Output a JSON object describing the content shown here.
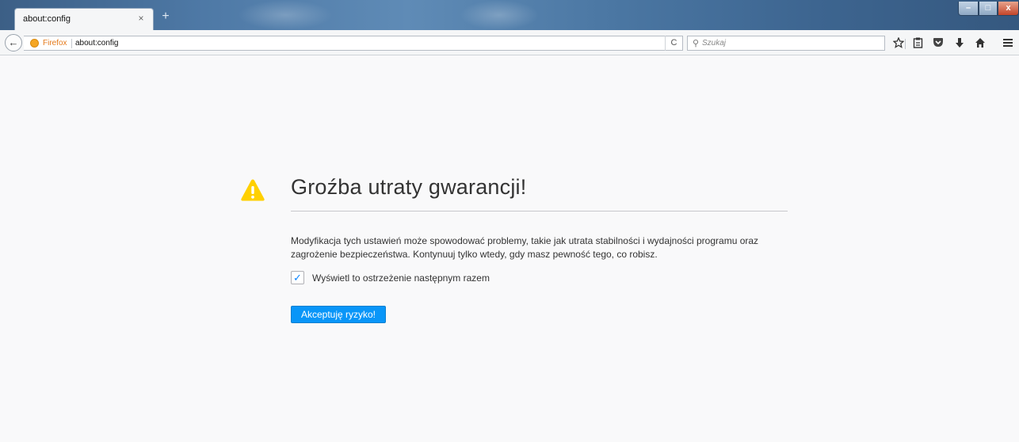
{
  "tab": {
    "title": "about:config",
    "close_glyph": "×",
    "new_tab_glyph": "+"
  },
  "window_controls": {
    "minimize": "–",
    "maximize": "□",
    "close": "x"
  },
  "navbar": {
    "back_glyph": "←",
    "identity_label": "Firefox",
    "url": "about:config",
    "reload_glyph": "C",
    "search_placeholder": "Szukaj",
    "search_icon_glyph": "⚲",
    "toolbar_icons": [
      "star-icon",
      "reading-list-icon",
      "pocket-icon",
      "download-icon",
      "home-icon",
      "menu-icon"
    ]
  },
  "warning": {
    "title": "Groźba utraty gwarancji!",
    "description": "Modyfikacja tych ustawień może spowodować problemy, takie jak utrata stabilności i wydajności programu oraz zagrożenie bezpieczeństwa. Kontynuuj tylko wtedy, gdy masz pewność tego, co robisz.",
    "checkbox_label": "Wyświetl to ostrzeżenie następnym razem",
    "checkbox_checked": true,
    "accept_button": "Akceptuję ryzyko!"
  },
  "colors": {
    "accent": "#0996f8",
    "warning": "#ffd000",
    "identity": "#e57b1d"
  }
}
